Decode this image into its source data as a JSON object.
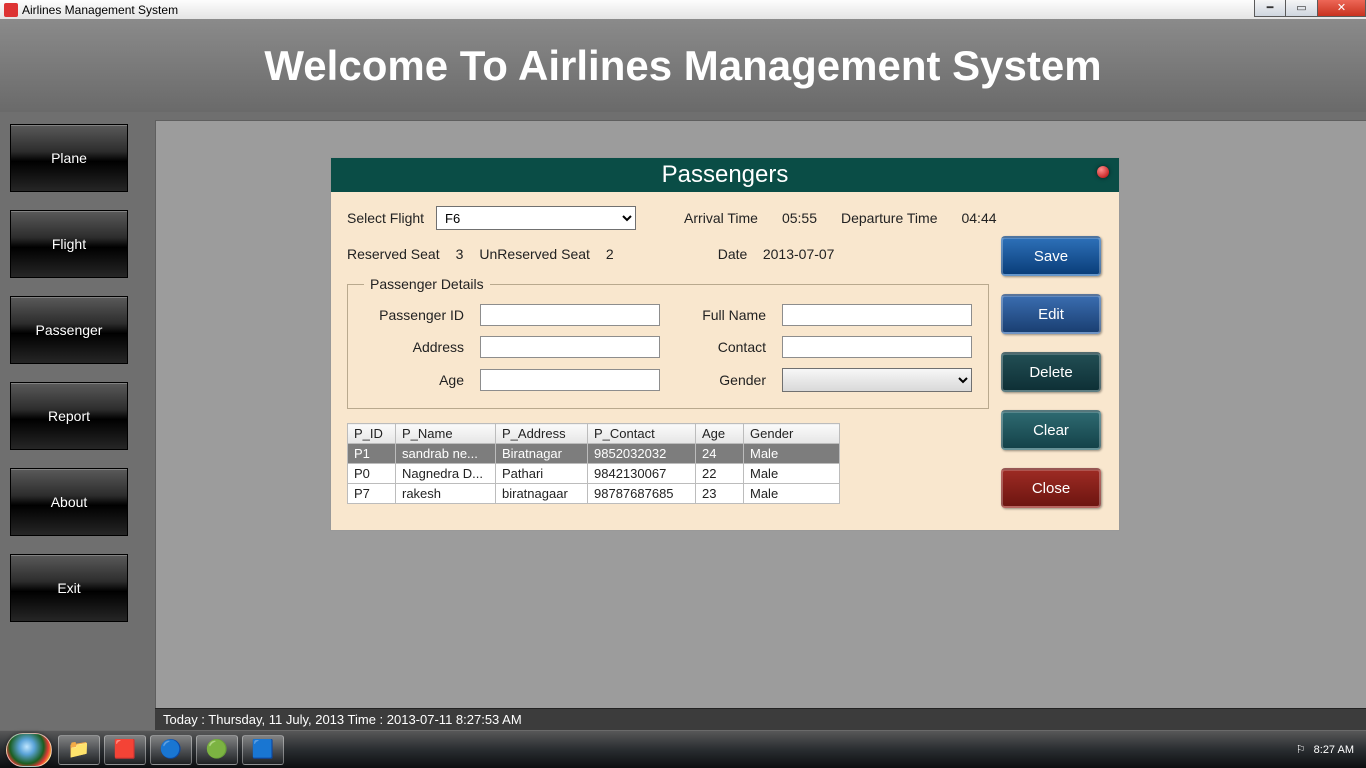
{
  "window": {
    "title": "Airlines Management System"
  },
  "header": {
    "title": "Welcome To Airlines Management System"
  },
  "sidebar": {
    "items": [
      {
        "label": "Plane"
      },
      {
        "label": "Flight"
      },
      {
        "label": "Passenger"
      },
      {
        "label": "Report"
      },
      {
        "label": "About"
      },
      {
        "label": "Exit"
      }
    ]
  },
  "form": {
    "title": "Passengers",
    "select_flight_label": "Select Flight",
    "select_flight_value": "F6",
    "arrival_label": "Arrival Time",
    "arrival_value": "05:55",
    "departure_label": "Departure Time",
    "departure_value": "04:44",
    "reserved_label": "Reserved Seat",
    "reserved_value": "3",
    "unreserved_label": "UnReserved Seat",
    "unreserved_value": "2",
    "date_label": "Date",
    "date_value": "2013-07-07",
    "details_legend": "Passenger Details",
    "fields": {
      "pid_label": "Passenger ID",
      "pid_value": "",
      "fullname_label": "Full Name",
      "fullname_value": "",
      "address_label": "Address",
      "address_value": "",
      "contact_label": "Contact",
      "contact_value": "",
      "age_label": "Age",
      "age_value": "",
      "gender_label": "Gender",
      "gender_value": ""
    },
    "table": {
      "headers": [
        "P_ID",
        "P_Name",
        "P_Address",
        "P_Contact",
        "Age",
        "Gender"
      ],
      "rows": [
        {
          "id": "P1",
          "name": "sandrab ne...",
          "addr": "Biratnagar",
          "contact": "9852032032",
          "age": "24",
          "gender": "Male",
          "selected": true
        },
        {
          "id": "P0",
          "name": "Nagnedra D...",
          "addr": "Pathari",
          "contact": "9842130067",
          "age": "22",
          "gender": "Male",
          "selected": false
        },
        {
          "id": "P7",
          "name": "rakesh",
          "addr": "biratnagaar",
          "contact": "98787687685",
          "age": "23",
          "gender": "Male",
          "selected": false
        }
      ]
    },
    "actions": {
      "save": "Save",
      "edit": "Edit",
      "delete": "Delete",
      "clear": "Clear",
      "close": "Close"
    }
  },
  "status": {
    "text": "Today : Thursday, 11 July, 2013   Time : 2013-07-11 8:27:53 AM"
  },
  "taskbar": {
    "time": "8:27 AM"
  }
}
